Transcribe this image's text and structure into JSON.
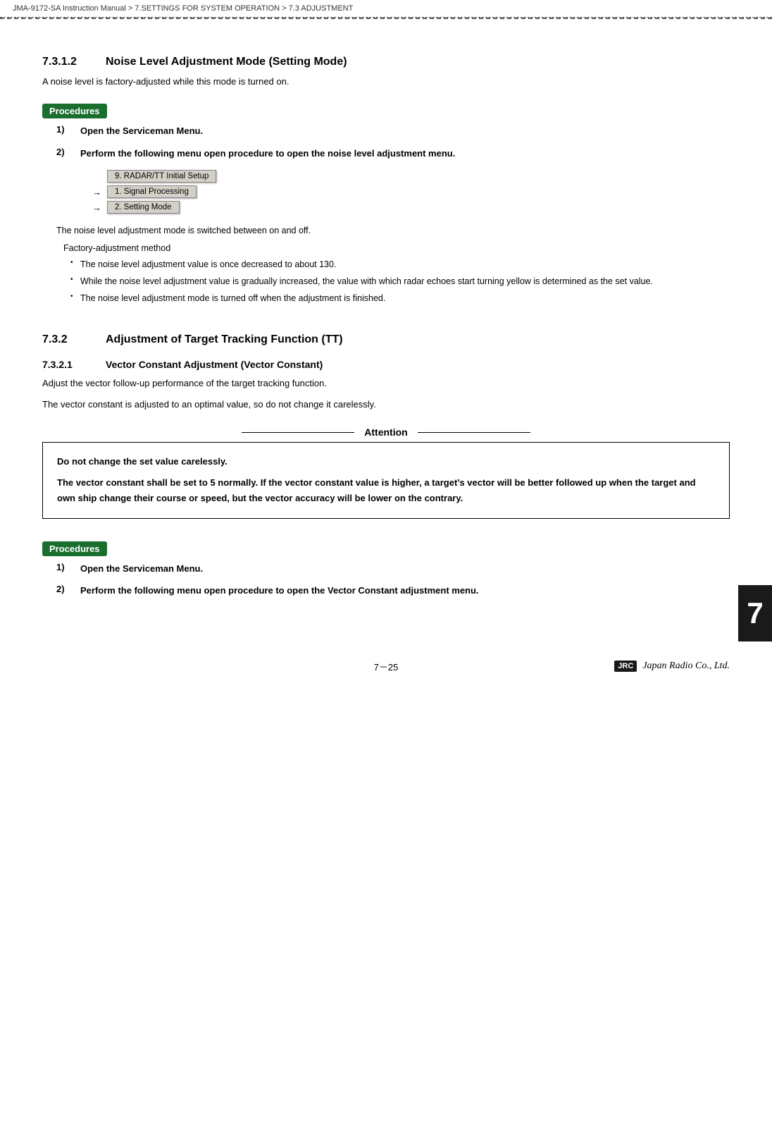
{
  "breadcrumb": {
    "text": "JMA-9172-SA Instruction Manual  >  7.SETTINGS FOR SYSTEM OPERATION  >  7.3  ADJUSTMENT"
  },
  "section_7312": {
    "num": "7.3.1.2",
    "title": "Noise Level Adjustment Mode (Setting Mode)",
    "intro": "A noise level is factory-adjusted while this mode is turned on."
  },
  "procedures_badge_1": "Procedures",
  "step1_1": {
    "num": "1)",
    "text": "Open the Serviceman Menu."
  },
  "step1_2": {
    "num": "2)",
    "text": "Perform the following menu open procedure to open the noise level adjustment menu."
  },
  "menu_chain_1": {
    "btn1": "9. RADAR/TT Initial Setup",
    "arrow2": "→",
    "btn2": "1. Signal Processing",
    "arrow3": "→",
    "btn3": "2. Setting Mode"
  },
  "noise_note": "The noise level adjustment mode is switched between on and off.",
  "factory_title": "Factory-adjustment method",
  "factory_bullets": [
    "The noise level adjustment value is once decreased to about 130.",
    "While the noise level adjustment value is gradually increased, the value with which radar echoes start turning yellow is determined as the set value.",
    "The noise level adjustment mode is turned off when the adjustment is finished."
  ],
  "section_732": {
    "num": "7.3.2",
    "title": "Adjustment of Target Tracking Function (TT)"
  },
  "section_7321": {
    "num": "7.3.2.1",
    "title": "Vector Constant Adjustment (Vector Constant)"
  },
  "section_7321_para1": "Adjust the vector follow-up performance of the target tracking function.",
  "section_7321_para2": "The vector constant is adjusted to an optimal value, so do not change it carelessly.",
  "attention_label": "Attention",
  "attention_line1": "Do not change the set value carelessly.",
  "attention_line2": "The vector constant shall be set to 5 normally.  If the vector constant value is higher, a target’s vector will be better followed up when the target and own ship change their course or speed, but the vector accuracy will be lower on the contrary.",
  "procedures_badge_2": "Procedures",
  "step2_1": {
    "num": "1)",
    "text": "Open the Serviceman Menu."
  },
  "step2_2": {
    "num": "2)",
    "text": "Perform the following menu open procedure to open the Vector Constant adjustment menu."
  },
  "chapter_num": "7",
  "footer_page": "7－25",
  "footer_jrc": "JRC",
  "footer_company": "Japan Radio Co., Ltd."
}
